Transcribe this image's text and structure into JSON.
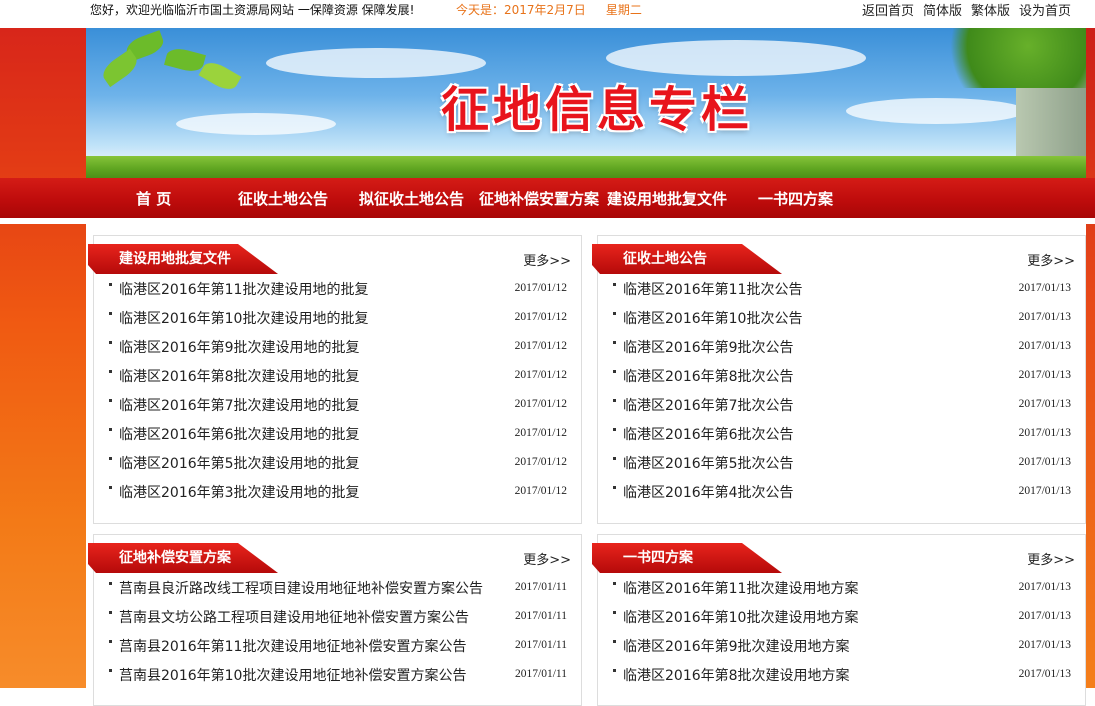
{
  "topbar": {
    "welcome": "您好，欢迎光临临沂市国土资源局网站 一保障资源  保障发展!",
    "date": "今天是：2017年2月7日",
    "weekday": "星期二",
    "links": [
      "返回首页",
      "简体版",
      "繁体版",
      "设为首页"
    ]
  },
  "banner": {
    "title": "征地信息专栏"
  },
  "nav": {
    "items": [
      "首  页",
      "征收土地公告",
      "拟征收土地公告",
      "征地补偿安置方案",
      "建设用地批复文件",
      "一书四方案"
    ]
  },
  "more_label": "更多>>",
  "panels": [
    {
      "title": "建设用地批复文件",
      "items": [
        {
          "text": "临港区2016年第11批次建设用地的批复",
          "date": "2017/01/12"
        },
        {
          "text": "临港区2016年第10批次建设用地的批复",
          "date": "2017/01/12"
        },
        {
          "text": "临港区2016年第9批次建设用地的批复",
          "date": "2017/01/12"
        },
        {
          "text": "临港区2016年第8批次建设用地的批复",
          "date": "2017/01/12"
        },
        {
          "text": "临港区2016年第7批次建设用地的批复",
          "date": "2017/01/12"
        },
        {
          "text": "临港区2016年第6批次建设用地的批复",
          "date": "2017/01/12"
        },
        {
          "text": "临港区2016年第5批次建设用地的批复",
          "date": "2017/01/12"
        },
        {
          "text": "临港区2016年第3批次建设用地的批复",
          "date": "2017/01/12"
        }
      ]
    },
    {
      "title": "征收土地公告",
      "items": [
        {
          "text": "临港区2016年第11批次公告",
          "date": "2017/01/13"
        },
        {
          "text": "临港区2016年第10批次公告",
          "date": "2017/01/13"
        },
        {
          "text": "临港区2016年第9批次公告",
          "date": "2017/01/13"
        },
        {
          "text": "临港区2016年第8批次公告",
          "date": "2017/01/13"
        },
        {
          "text": "临港区2016年第7批次公告",
          "date": "2017/01/13"
        },
        {
          "text": "临港区2016年第6批次公告",
          "date": "2017/01/13"
        },
        {
          "text": "临港区2016年第5批次公告",
          "date": "2017/01/13"
        },
        {
          "text": "临港区2016年第4批次公告",
          "date": "2017/01/13"
        }
      ]
    },
    {
      "title": "征地补偿安置方案",
      "items": [
        {
          "text": "莒南县良沂路改线工程项目建设用地征地补偿安置方案公告",
          "date": "2017/01/11"
        },
        {
          "text": "莒南县文坊公路工程项目建设用地征地补偿安置方案公告",
          "date": "2017/01/11"
        },
        {
          "text": "莒南县2016年第11批次建设用地征地补偿安置方案公告",
          "date": "2017/01/11"
        },
        {
          "text": "莒南县2016年第10批次建设用地征地补偿安置方案公告",
          "date": "2017/01/11"
        }
      ]
    },
    {
      "title": "一书四方案",
      "items": [
        {
          "text": "临港区2016年第11批次建设用地方案",
          "date": "2017/01/13"
        },
        {
          "text": "临港区2016年第10批次建设用地方案",
          "date": "2017/01/13"
        },
        {
          "text": "临港区2016年第9批次建设用地方案",
          "date": "2017/01/13"
        },
        {
          "text": "临港区2016年第8批次建设用地方案",
          "date": "2017/01/13"
        }
      ]
    }
  ]
}
